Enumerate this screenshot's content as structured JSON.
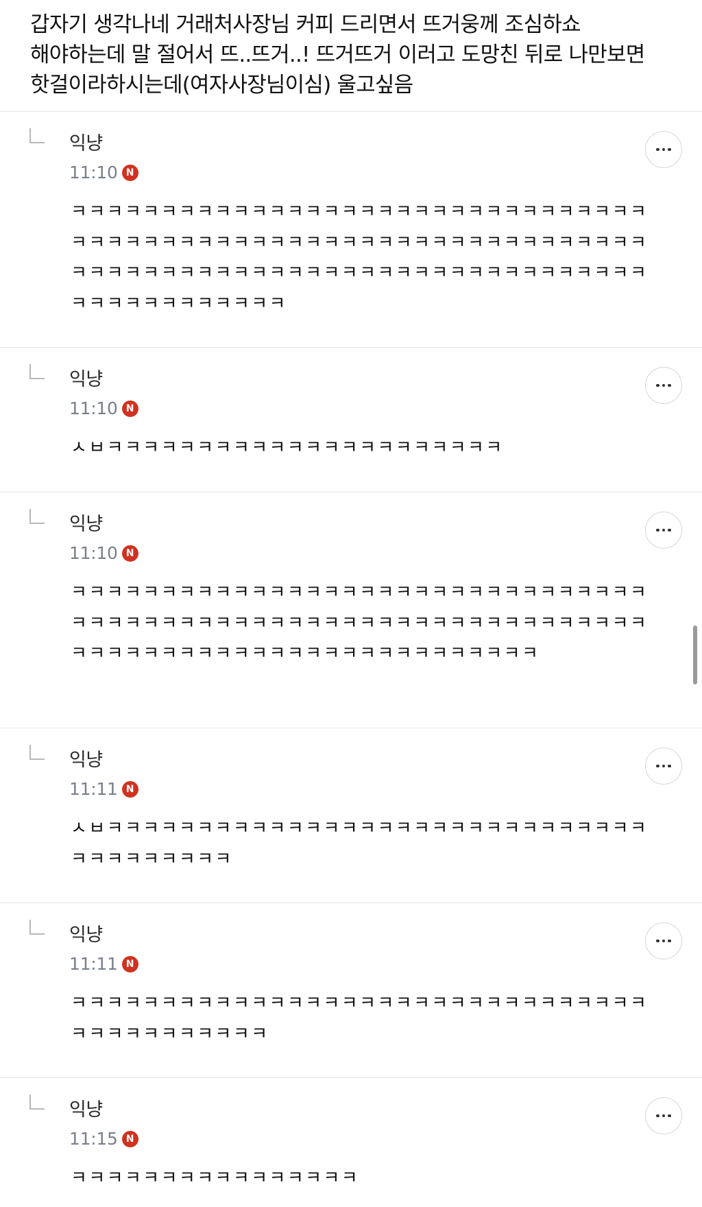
{
  "post": {
    "text": "갑자기 생각나네 거래처사장님 커피 드리면서 뜨거웅께 조심하쇼 해야하는데 말 절어서 뜨..뜨거..! 뜨거뜨거 이러고 도망친 뒤로 나만보면 핫걸이라하시는데(여자사장님이심) 울고싶음"
  },
  "comments": [
    {
      "author": "익냥",
      "time": "11:10",
      "badge": "N",
      "text": "ㅋㅋㅋㅋㅋㅋㅋㅋㅋㅋㅋㅋㅋㅋㅋㅋㅋㅋㅋㅋㅋㅋㅋㅋㅋㅋㅋㅋㅋㅋㅋㅋㅋㅋㅋㅋㅋㅋㅋㅋㅋㅋㅋㅋㅋㅋㅋㅋㅋㅋㅋㅋㅋㅋㅋㅋㅋㅋㅋㅋㅋㅋㅋㅋㅋㅋㅋㅋㅋㅋㅋㅋㅋㅋㅋㅋㅋㅋㅋㅋㅋㅋㅋㅋㅋㅋㅋㅋㅋㅋㅋㅋㅋㅋㅋㅋㅋㅋㅋㅋㅋㅋㅋㅋㅋㅋㅋㅋ"
    },
    {
      "author": "익냥",
      "time": "11:10",
      "badge": "N",
      "text": "ㅅㅂㅋㅋㅋㅋㅋㅋㅋㅋㅋㅋㅋㅋㅋㅋㅋㅋㅋㅋㅋㅋㅋㅋ"
    },
    {
      "author": "익냥",
      "time": "11:10",
      "badge": "N",
      "text": "ㅋㅋㅋㅋㅋㅋㅋㅋㅋㅋㅋㅋㅋㅋㅋㅋㅋㅋㅋㅋㅋㅋㅋㅋㅋㅋㅋㅋㅋㅋㅋㅋㅋㅋㅋㅋㅋㅋㅋㅋㅋㅋㅋㅋㅋㅋㅋㅋㅋㅋㅋㅋㅋㅋㅋㅋㅋㅋㅋㅋㅋㅋㅋㅋㅋㅋㅋㅋㅋㅋㅋㅋㅋㅋㅋㅋㅋㅋㅋㅋㅋㅋㅋㅋㅋㅋㅋㅋㅋㅋ"
    },
    {
      "author": "익냥",
      "time": "11:11",
      "badge": "N",
      "text": "ㅅㅂㅋㅋㅋㅋㅋㅋㅋㅋㅋㅋㅋㅋㅋㅋㅋㅋㅋㅋㅋㅋㅋㅋㅋㅋㅋㅋㅋㅋㅋㅋㅋㅋㅋㅋㅋㅋㅋㅋㅋ"
    },
    {
      "author": "익냥",
      "time": "11:11",
      "badge": "N",
      "text": "ㅋㅋㅋㅋㅋㅋㅋㅋㅋㅋㅋㅋㅋㅋㅋㅋㅋㅋㅋㅋㅋㅋㅋㅋㅋㅋㅋㅋㅋㅋㅋㅋㅋㅋㅋㅋㅋㅋㅋㅋㅋㅋㅋ"
    },
    {
      "author": "익냥",
      "time": "11:15",
      "badge": "N",
      "text": "ㅋㅋㅋㅋㅋㅋㅋㅋㅋㅋㅋㅋㅋㅋㅋㅋ"
    }
  ],
  "icons": {
    "reply": "reply-arrow-icon",
    "more": "more-horizontal-icon",
    "new": "new-badge-icon"
  },
  "colors": {
    "new_badge": "#d0321f",
    "time": "#7a7f8c",
    "divider": "#e6e6e6"
  }
}
